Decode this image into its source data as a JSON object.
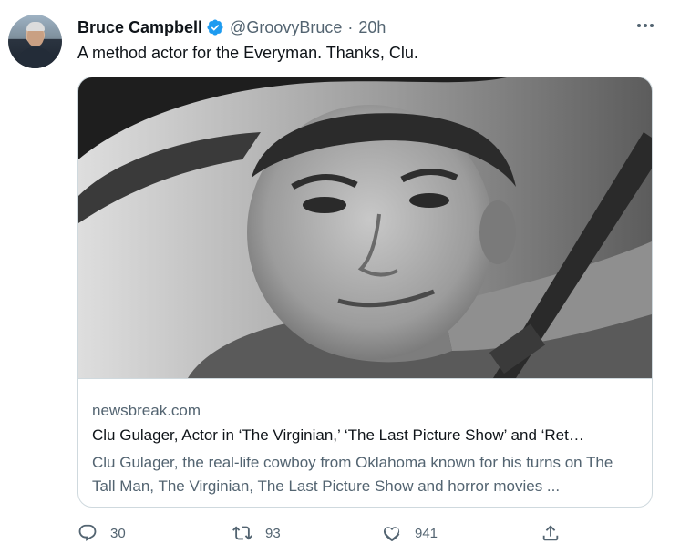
{
  "tweet": {
    "author_name": "Bruce Campbell",
    "handle": "@GroovyBruce",
    "separator": "·",
    "time": "20h",
    "text": "A method actor for the Everyman. Thanks, Clu."
  },
  "card": {
    "image_icon": "portrait-photo",
    "domain": "newsbreak.com",
    "title": "Clu Gulager, Actor in ‘The Virginian,’ ‘The Last Picture Show’ and ‘Ret…",
    "description": "Clu Gulager, the real-life cowboy from Oklahoma known for his turns on The Tall Man, The Virginian, The Last Picture Show and horror movies ..."
  },
  "actions": {
    "reply_count": "30",
    "retweet_count": "93",
    "like_count": "941"
  },
  "colors": {
    "verified": "#1d9bf0",
    "secondary_text": "#536471",
    "border": "#cfd9de"
  }
}
